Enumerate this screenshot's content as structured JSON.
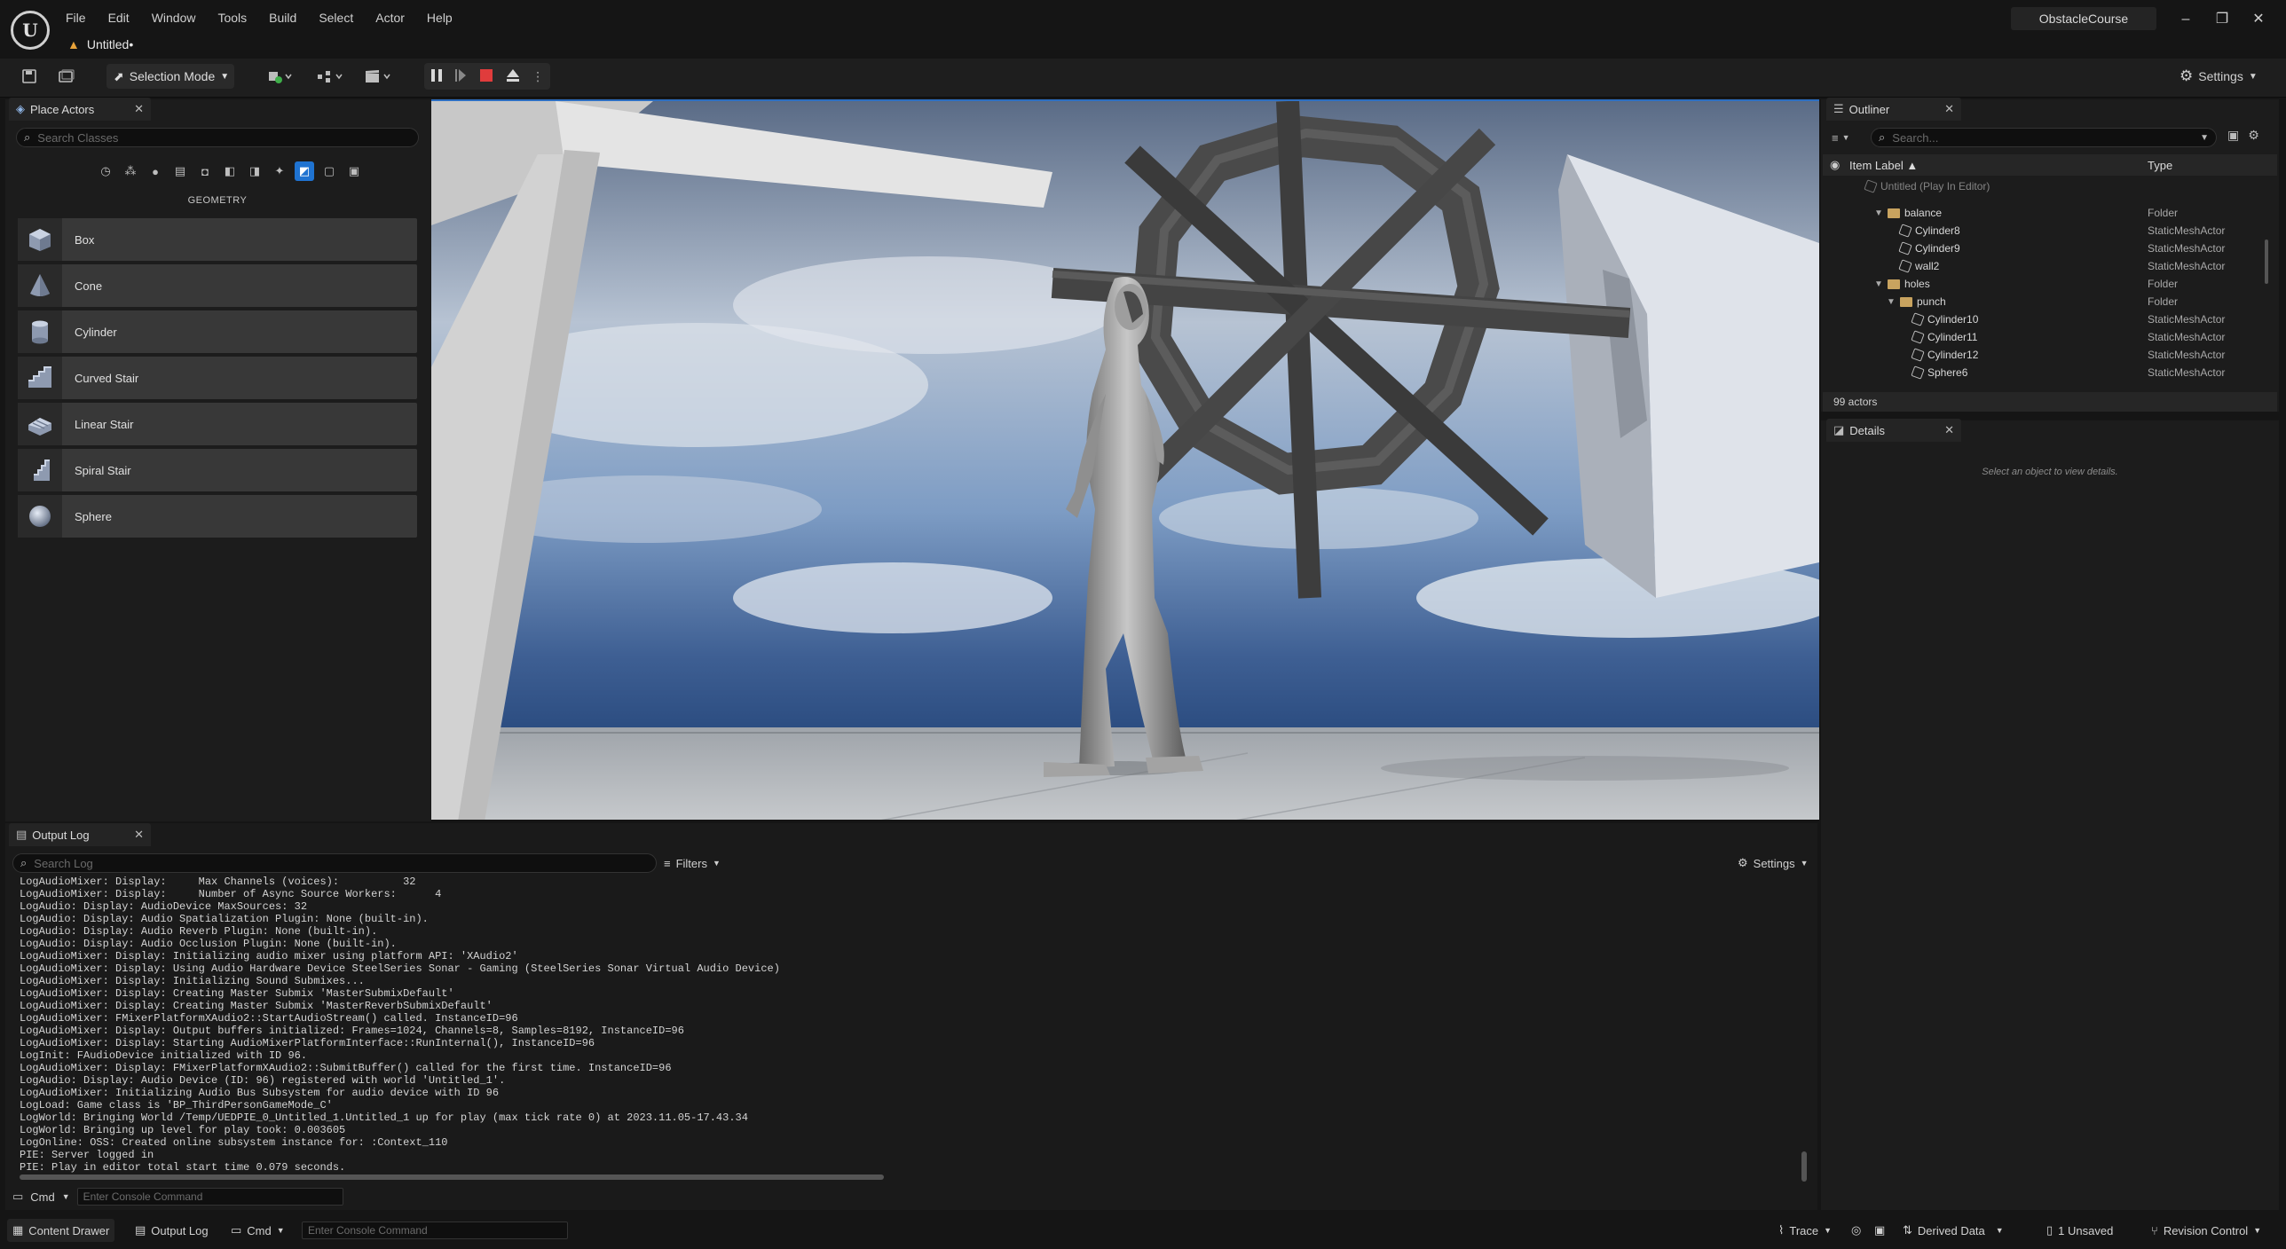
{
  "app": {
    "menu": [
      "File",
      "Edit",
      "Window",
      "Tools",
      "Build",
      "Select",
      "Actor",
      "Help"
    ],
    "document_tab": "Untitled•",
    "project_name": "ObstacleCourse",
    "window_controls": [
      "–",
      "❐",
      "✕"
    ]
  },
  "toolbar": {
    "mode_label": "Selection Mode",
    "settings_label": "Settings"
  },
  "place_actors": {
    "tab_label": "Place Actors",
    "search_placeholder": "Search Classes",
    "section_title": "GEOMETRY",
    "items": [
      {
        "label": "Box",
        "icon": "box-icon"
      },
      {
        "label": "Cone",
        "icon": "cone-icon"
      },
      {
        "label": "Cylinder",
        "icon": "cylinder-icon"
      },
      {
        "label": "Curved Stair",
        "icon": "curved-stair-icon"
      },
      {
        "label": "Linear Stair",
        "icon": "linear-stair-icon"
      },
      {
        "label": "Spiral Stair",
        "icon": "spiral-stair-icon"
      },
      {
        "label": "Sphere",
        "icon": "sphere-icon"
      }
    ]
  },
  "outliner": {
    "tab_label": "Outliner",
    "search_placeholder": "Search...",
    "col_label": "Item Label ▲",
    "col_type": "Type",
    "root": "Untitled (Play In Editor)",
    "rows": [
      {
        "label": "balance",
        "type": "Folder",
        "kind": "folder",
        "depth": 1,
        "expanded": true
      },
      {
        "label": "Cylinder8",
        "type": "StaticMeshActor",
        "kind": "mesh",
        "depth": 2
      },
      {
        "label": "Cylinder9",
        "type": "StaticMeshActor",
        "kind": "mesh",
        "depth": 2
      },
      {
        "label": "wall2",
        "type": "StaticMeshActor",
        "kind": "mesh",
        "depth": 2
      },
      {
        "label": "holes",
        "type": "Folder",
        "kind": "folder",
        "depth": 1,
        "expanded": true
      },
      {
        "label": "punch",
        "type": "Folder",
        "kind": "folder",
        "depth": 2,
        "expanded": true
      },
      {
        "label": "Cylinder10",
        "type": "StaticMeshActor",
        "kind": "mesh",
        "depth": 3
      },
      {
        "label": "Cylinder11",
        "type": "StaticMeshActor",
        "kind": "mesh",
        "depth": 3
      },
      {
        "label": "Cylinder12",
        "type": "StaticMeshActor",
        "kind": "mesh",
        "depth": 3
      },
      {
        "label": "Sphere6",
        "type": "StaticMeshActor",
        "kind": "mesh",
        "depth": 3
      }
    ],
    "count": "99 actors"
  },
  "details": {
    "tab_label": "Details",
    "empty_message": "Select an object to view details."
  },
  "output_log": {
    "tab_label": "Output Log",
    "search_placeholder": "Search Log",
    "filters_label": "Filters",
    "settings_label": "Settings",
    "lines": [
      "LogAudioMixer: Display:     Max Channels (voices):          32",
      "LogAudioMixer: Display:     Number of Async Source Workers:      4",
      "LogAudio: Display: AudioDevice MaxSources: 32",
      "LogAudio: Display: Audio Spatialization Plugin: None (built-in).",
      "LogAudio: Display: Audio Reverb Plugin: None (built-in).",
      "LogAudio: Display: Audio Occlusion Plugin: None (built-in).",
      "LogAudioMixer: Display: Initializing audio mixer using platform API: 'XAudio2'",
      "LogAudioMixer: Display: Using Audio Hardware Device SteelSeries Sonar - Gaming (SteelSeries Sonar Virtual Audio Device)",
      "LogAudioMixer: Display: Initializing Sound Submixes...",
      "LogAudioMixer: Display: Creating Master Submix 'MasterSubmixDefault'",
      "LogAudioMixer: Display: Creating Master Submix 'MasterReverbSubmixDefault'",
      "LogAudioMixer: FMixerPlatformXAudio2::StartAudioStream() called. InstanceID=96",
      "LogAudioMixer: Display: Output buffers initialized: Frames=1024, Channels=8, Samples=8192, InstanceID=96",
      "LogAudioMixer: Display: Starting AudioMixerPlatformInterface::RunInternal(), InstanceID=96",
      "LogInit: FAudioDevice initialized with ID 96.",
      "LogAudioMixer: Display: FMixerPlatformXAudio2::SubmitBuffer() called for the first time. InstanceID=96",
      "LogAudio: Display: Audio Device (ID: 96) registered with world 'Untitled_1'.",
      "LogAudioMixer: Initializing Audio Bus Subsystem for audio device with ID 96",
      "LogLoad: Game class is 'BP_ThirdPersonGameMode_C'",
      "LogWorld: Bringing World /Temp/UEDPIE_0_Untitled_1.Untitled_1 up for play (max tick rate 0) at 2023.11.05-17.43.34",
      "LogWorld: Bringing up level for play took: 0.003605",
      "LogOnline: OSS: Created online subsystem instance for: :Context_110",
      "PIE: Server logged in",
      "PIE: Play in editor total start time 0.079 seconds."
    ],
    "cmd_label": "Cmd",
    "cmd_placeholder": "Enter Console Command"
  },
  "statusbar": {
    "content_drawer": "Content Drawer",
    "output_log": "Output Log",
    "cmd_label": "Cmd",
    "cmd_placeholder": "Enter Console Command",
    "trace": "Trace",
    "derived_data": "Derived Data",
    "unsaved": "1 Unsaved",
    "revision_control": "Revision Control"
  },
  "colors": {
    "accent": "#1f73d1",
    "stop": "#e03c3c",
    "folder": "#c8a35f",
    "warning": "#e8a33a"
  }
}
